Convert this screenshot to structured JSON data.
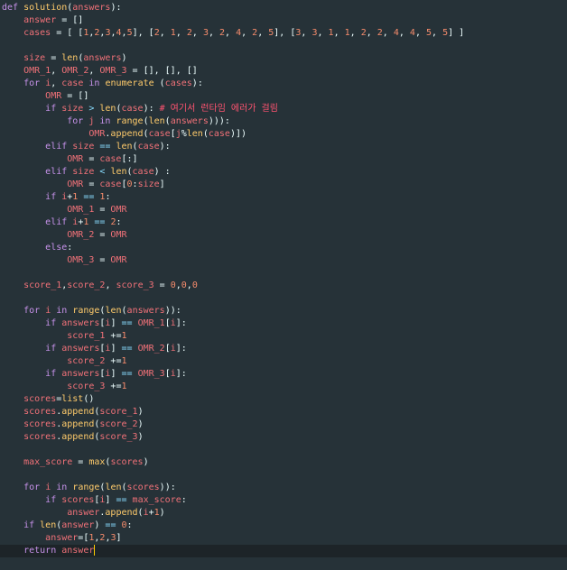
{
  "editor": {
    "language": "python",
    "colors": {
      "background": "#263238",
      "active_line": "#1d2428",
      "keyword": "#c792ea",
      "function": "#ffcb6b",
      "variable": "#f07178",
      "number": "#f78c6c",
      "operator": "#89ddff",
      "text": "#eeffff",
      "comment": "#ff5370"
    },
    "cursor_line": 44,
    "lines": [
      [
        [
          "kw",
          "def "
        ],
        [
          "fn",
          "solution"
        ],
        [
          "txt",
          "("
        ],
        [
          "var",
          "answers"
        ],
        [
          "txt",
          "):"
        ]
      ],
      [
        [
          "txt",
          "    "
        ],
        [
          "var",
          "answer"
        ],
        [
          "txt",
          " = []"
        ]
      ],
      [
        [
          "txt",
          "    "
        ],
        [
          "var",
          "cases"
        ],
        [
          "txt",
          " = [ ["
        ],
        [
          "num",
          "1"
        ],
        [
          "txt",
          ","
        ],
        [
          "num",
          "2"
        ],
        [
          "txt",
          ","
        ],
        [
          "num",
          "3"
        ],
        [
          "txt",
          ","
        ],
        [
          "num",
          "4"
        ],
        [
          "txt",
          ","
        ],
        [
          "num",
          "5"
        ],
        [
          "txt",
          "], ["
        ],
        [
          "num",
          "2"
        ],
        [
          "txt",
          ", "
        ],
        [
          "num",
          "1"
        ],
        [
          "txt",
          ", "
        ],
        [
          "num",
          "2"
        ],
        [
          "txt",
          ", "
        ],
        [
          "num",
          "3"
        ],
        [
          "txt",
          ", "
        ],
        [
          "num",
          "2"
        ],
        [
          "txt",
          ", "
        ],
        [
          "num",
          "4"
        ],
        [
          "txt",
          ", "
        ],
        [
          "num",
          "2"
        ],
        [
          "txt",
          ", "
        ],
        [
          "num",
          "5"
        ],
        [
          "txt",
          "], ["
        ],
        [
          "num",
          "3"
        ],
        [
          "txt",
          ", "
        ],
        [
          "num",
          "3"
        ],
        [
          "txt",
          ", "
        ],
        [
          "num",
          "1"
        ],
        [
          "txt",
          ", "
        ],
        [
          "num",
          "1"
        ],
        [
          "txt",
          ", "
        ],
        [
          "num",
          "2"
        ],
        [
          "txt",
          ", "
        ],
        [
          "num",
          "2"
        ],
        [
          "txt",
          ", "
        ],
        [
          "num",
          "4"
        ],
        [
          "txt",
          ", "
        ],
        [
          "num",
          "4"
        ],
        [
          "txt",
          ", "
        ],
        [
          "num",
          "5"
        ],
        [
          "txt",
          ", "
        ],
        [
          "num",
          "5"
        ],
        [
          "txt",
          "] ]"
        ]
      ],
      [],
      [
        [
          "txt",
          "    "
        ],
        [
          "var",
          "size"
        ],
        [
          "txt",
          " = "
        ],
        [
          "fn",
          "len"
        ],
        [
          "txt",
          "("
        ],
        [
          "var",
          "answers"
        ],
        [
          "txt",
          ")"
        ]
      ],
      [
        [
          "txt",
          "    "
        ],
        [
          "var",
          "OMR_1"
        ],
        [
          "txt",
          ", "
        ],
        [
          "var",
          "OMR_2"
        ],
        [
          "txt",
          ", "
        ],
        [
          "var",
          "OMR_3"
        ],
        [
          "txt",
          " = [], [], []"
        ]
      ],
      [
        [
          "txt",
          "    "
        ],
        [
          "kw",
          "for "
        ],
        [
          "var",
          "i"
        ],
        [
          "txt",
          ", "
        ],
        [
          "var",
          "case"
        ],
        [
          "kw",
          " in "
        ],
        [
          "fn",
          "enumerate"
        ],
        [
          "txt",
          " ("
        ],
        [
          "var",
          "cases"
        ],
        [
          "txt",
          "):"
        ]
      ],
      [
        [
          "txt",
          "        "
        ],
        [
          "var",
          "OMR"
        ],
        [
          "txt",
          " = []"
        ]
      ],
      [
        [
          "txt",
          "        "
        ],
        [
          "kw",
          "if "
        ],
        [
          "var",
          "size"
        ],
        [
          "op",
          " > "
        ],
        [
          "fn",
          "len"
        ],
        [
          "txt",
          "("
        ],
        [
          "var",
          "case"
        ],
        [
          "txt",
          "): "
        ],
        [
          "cm",
          "# 여기서 런타임 에러가 걸림"
        ]
      ],
      [
        [
          "txt",
          "            "
        ],
        [
          "kw",
          "for "
        ],
        [
          "var",
          "j"
        ],
        [
          "kw",
          " in "
        ],
        [
          "fn",
          "range"
        ],
        [
          "txt",
          "("
        ],
        [
          "fn",
          "len"
        ],
        [
          "txt",
          "("
        ],
        [
          "var",
          "answers"
        ],
        [
          "txt",
          "))):"
        ]
      ],
      [
        [
          "txt",
          "                "
        ],
        [
          "var",
          "OMR"
        ],
        [
          "txt",
          "."
        ],
        [
          "fn",
          "append"
        ],
        [
          "txt",
          "("
        ],
        [
          "var",
          "case"
        ],
        [
          "txt",
          "["
        ],
        [
          "var",
          "j"
        ],
        [
          "txt",
          "%"
        ],
        [
          "fn",
          "len"
        ],
        [
          "txt",
          "("
        ],
        [
          "var",
          "case"
        ],
        [
          "txt",
          ")])"
        ]
      ],
      [
        [
          "txt",
          "        "
        ],
        [
          "kw",
          "elif "
        ],
        [
          "var",
          "size"
        ],
        [
          "op",
          " == "
        ],
        [
          "fn",
          "len"
        ],
        [
          "txt",
          "("
        ],
        [
          "var",
          "case"
        ],
        [
          "txt",
          "):"
        ]
      ],
      [
        [
          "txt",
          "            "
        ],
        [
          "var",
          "OMR"
        ],
        [
          "txt",
          " = "
        ],
        [
          "var",
          "case"
        ],
        [
          "txt",
          "[:]"
        ]
      ],
      [
        [
          "txt",
          "        "
        ],
        [
          "kw",
          "elif "
        ],
        [
          "var",
          "size"
        ],
        [
          "op",
          " < "
        ],
        [
          "fn",
          "len"
        ],
        [
          "txt",
          "("
        ],
        [
          "var",
          "case"
        ],
        [
          "txt",
          ") :"
        ]
      ],
      [
        [
          "txt",
          "            "
        ],
        [
          "var",
          "OMR"
        ],
        [
          "txt",
          " = "
        ],
        [
          "var",
          "case"
        ],
        [
          "txt",
          "["
        ],
        [
          "num",
          "0"
        ],
        [
          "txt",
          ":"
        ],
        [
          "var",
          "size"
        ],
        [
          "txt",
          "]"
        ]
      ],
      [
        [
          "txt",
          "        "
        ],
        [
          "kw",
          "if "
        ],
        [
          "var",
          "i"
        ],
        [
          "txt",
          "+"
        ],
        [
          "num",
          "1"
        ],
        [
          "op",
          " == "
        ],
        [
          "num",
          "1"
        ],
        [
          "txt",
          ":"
        ]
      ],
      [
        [
          "txt",
          "            "
        ],
        [
          "var",
          "OMR_1"
        ],
        [
          "txt",
          " = "
        ],
        [
          "var",
          "OMR"
        ]
      ],
      [
        [
          "txt",
          "        "
        ],
        [
          "kw",
          "elif "
        ],
        [
          "var",
          "i"
        ],
        [
          "txt",
          "+"
        ],
        [
          "num",
          "1"
        ],
        [
          "op",
          " == "
        ],
        [
          "num",
          "2"
        ],
        [
          "txt",
          ":"
        ]
      ],
      [
        [
          "txt",
          "            "
        ],
        [
          "var",
          "OMR_2"
        ],
        [
          "txt",
          " = "
        ],
        [
          "var",
          "OMR"
        ]
      ],
      [
        [
          "txt",
          "        "
        ],
        [
          "kw",
          "else"
        ],
        [
          "txt",
          ":"
        ]
      ],
      [
        [
          "txt",
          "            "
        ],
        [
          "var",
          "OMR_3"
        ],
        [
          "txt",
          " = "
        ],
        [
          "var",
          "OMR"
        ]
      ],
      [],
      [
        [
          "txt",
          "    "
        ],
        [
          "var",
          "score_1"
        ],
        [
          "txt",
          ","
        ],
        [
          "var",
          "score_2"
        ],
        [
          "txt",
          ", "
        ],
        [
          "var",
          "score_3"
        ],
        [
          "txt",
          " = "
        ],
        [
          "num",
          "0"
        ],
        [
          "txt",
          ","
        ],
        [
          "num",
          "0"
        ],
        [
          "txt",
          ","
        ],
        [
          "num",
          "0"
        ]
      ],
      [],
      [
        [
          "txt",
          "    "
        ],
        [
          "kw",
          "for "
        ],
        [
          "var",
          "i"
        ],
        [
          "kw",
          " in "
        ],
        [
          "fn",
          "range"
        ],
        [
          "txt",
          "("
        ],
        [
          "fn",
          "len"
        ],
        [
          "txt",
          "("
        ],
        [
          "var",
          "answers"
        ],
        [
          "txt",
          ")):"
        ]
      ],
      [
        [
          "txt",
          "        "
        ],
        [
          "kw",
          "if "
        ],
        [
          "var",
          "answers"
        ],
        [
          "txt",
          "["
        ],
        [
          "var",
          "i"
        ],
        [
          "txt",
          "]"
        ],
        [
          "op",
          " == "
        ],
        [
          "var",
          "OMR_1"
        ],
        [
          "txt",
          "["
        ],
        [
          "var",
          "i"
        ],
        [
          "txt",
          "]:"
        ]
      ],
      [
        [
          "txt",
          "            "
        ],
        [
          "var",
          "score_1"
        ],
        [
          "txt",
          " +="
        ],
        [
          "num",
          "1"
        ]
      ],
      [
        [
          "txt",
          "        "
        ],
        [
          "kw",
          "if "
        ],
        [
          "var",
          "answers"
        ],
        [
          "txt",
          "["
        ],
        [
          "var",
          "i"
        ],
        [
          "txt",
          "]"
        ],
        [
          "op",
          " == "
        ],
        [
          "var",
          "OMR_2"
        ],
        [
          "txt",
          "["
        ],
        [
          "var",
          "i"
        ],
        [
          "txt",
          "]:"
        ]
      ],
      [
        [
          "txt",
          "            "
        ],
        [
          "var",
          "score_2"
        ],
        [
          "txt",
          " +="
        ],
        [
          "num",
          "1"
        ]
      ],
      [
        [
          "txt",
          "        "
        ],
        [
          "kw",
          "if "
        ],
        [
          "var",
          "answers"
        ],
        [
          "txt",
          "["
        ],
        [
          "var",
          "i"
        ],
        [
          "txt",
          "]"
        ],
        [
          "op",
          " == "
        ],
        [
          "var",
          "OMR_3"
        ],
        [
          "txt",
          "["
        ],
        [
          "var",
          "i"
        ],
        [
          "txt",
          "]:"
        ]
      ],
      [
        [
          "txt",
          "            "
        ],
        [
          "var",
          "score_3"
        ],
        [
          "txt",
          " +="
        ],
        [
          "num",
          "1"
        ]
      ],
      [
        [
          "txt",
          "    "
        ],
        [
          "var",
          "scores"
        ],
        [
          "txt",
          "="
        ],
        [
          "fn",
          "list"
        ],
        [
          "txt",
          "()"
        ]
      ],
      [
        [
          "txt",
          "    "
        ],
        [
          "var",
          "scores"
        ],
        [
          "txt",
          "."
        ],
        [
          "fn",
          "append"
        ],
        [
          "txt",
          "("
        ],
        [
          "var",
          "score_1"
        ],
        [
          "txt",
          ")"
        ]
      ],
      [
        [
          "txt",
          "    "
        ],
        [
          "var",
          "scores"
        ],
        [
          "txt",
          "."
        ],
        [
          "fn",
          "append"
        ],
        [
          "txt",
          "("
        ],
        [
          "var",
          "score_2"
        ],
        [
          "txt",
          ")"
        ]
      ],
      [
        [
          "txt",
          "    "
        ],
        [
          "var",
          "scores"
        ],
        [
          "txt",
          "."
        ],
        [
          "fn",
          "append"
        ],
        [
          "txt",
          "("
        ],
        [
          "var",
          "score_3"
        ],
        [
          "txt",
          ")"
        ]
      ],
      [],
      [
        [
          "txt",
          "    "
        ],
        [
          "var",
          "max_score"
        ],
        [
          "txt",
          " = "
        ],
        [
          "fn",
          "max"
        ],
        [
          "txt",
          "("
        ],
        [
          "var",
          "scores"
        ],
        [
          "txt",
          ")"
        ]
      ],
      [],
      [
        [
          "txt",
          "    "
        ],
        [
          "kw",
          "for "
        ],
        [
          "var",
          "i"
        ],
        [
          "kw",
          " in "
        ],
        [
          "fn",
          "range"
        ],
        [
          "txt",
          "("
        ],
        [
          "fn",
          "len"
        ],
        [
          "txt",
          "("
        ],
        [
          "var",
          "scores"
        ],
        [
          "txt",
          ")):"
        ]
      ],
      [
        [
          "txt",
          "        "
        ],
        [
          "kw",
          "if "
        ],
        [
          "var",
          "scores"
        ],
        [
          "txt",
          "["
        ],
        [
          "var",
          "i"
        ],
        [
          "txt",
          "]"
        ],
        [
          "op",
          " == "
        ],
        [
          "var",
          "max_score"
        ],
        [
          "txt",
          ":"
        ]
      ],
      [
        [
          "txt",
          "            "
        ],
        [
          "var",
          "answer"
        ],
        [
          "txt",
          "."
        ],
        [
          "fn",
          "append"
        ],
        [
          "txt",
          "("
        ],
        [
          "var",
          "i"
        ],
        [
          "txt",
          "+"
        ],
        [
          "num",
          "1"
        ],
        [
          "txt",
          ")"
        ]
      ],
      [
        [
          "txt",
          "    "
        ],
        [
          "kw",
          "if "
        ],
        [
          "fn",
          "len"
        ],
        [
          "txt",
          "("
        ],
        [
          "var",
          "answer"
        ],
        [
          "txt",
          ")"
        ],
        [
          "op",
          " == "
        ],
        [
          "num",
          "0"
        ],
        [
          "txt",
          ":"
        ]
      ],
      [
        [
          "txt",
          "        "
        ],
        [
          "var",
          "answer"
        ],
        [
          "txt",
          "=["
        ],
        [
          "num",
          "1"
        ],
        [
          "txt",
          ","
        ],
        [
          "num",
          "2"
        ],
        [
          "txt",
          ","
        ],
        [
          "num",
          "3"
        ],
        [
          "txt",
          "]"
        ]
      ],
      [
        [
          "txt",
          "    "
        ],
        [
          "kw",
          "return "
        ],
        [
          "var",
          "answer"
        ]
      ]
    ]
  }
}
